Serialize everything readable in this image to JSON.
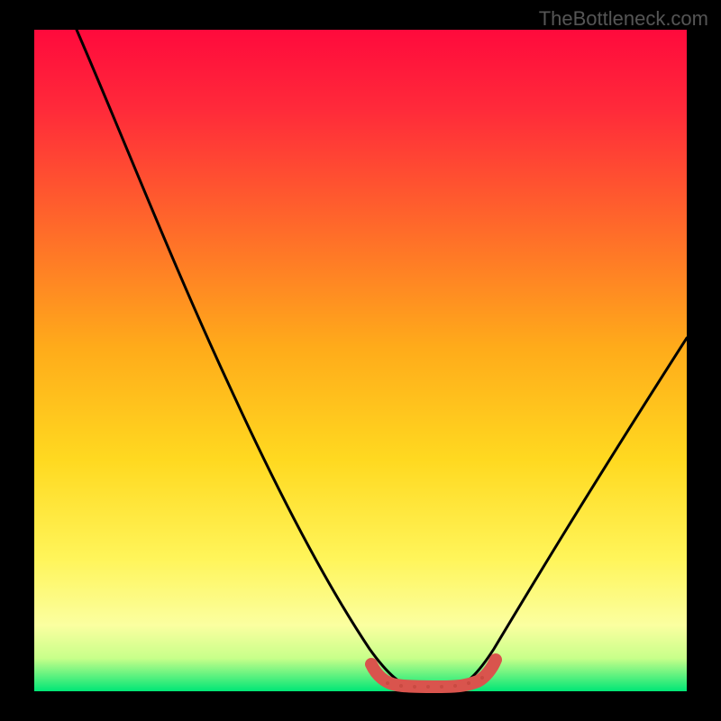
{
  "watermark": "TheBottleneck.com",
  "chart_data": {
    "type": "line",
    "title": "",
    "xlabel": "",
    "ylabel": "",
    "xlim": [
      0,
      100
    ],
    "ylim": [
      0,
      100
    ],
    "legend": false,
    "grid": false,
    "annotations": [],
    "background": {
      "style": "heat-gradient",
      "stops": [
        {
          "offset": 0,
          "color": "#ff1744"
        },
        {
          "offset": 50,
          "color": "#ffd740"
        },
        {
          "offset": 88,
          "color": "#ffff8d"
        },
        {
          "offset": 100,
          "color": "#00e676"
        }
      ]
    },
    "series": [
      {
        "name": "bottleneck-curve",
        "color": "#000000",
        "x": [
          9,
          14,
          20,
          26,
          32,
          38,
          44,
          48,
          52,
          56,
          58,
          60,
          62,
          66,
          72,
          80,
          90,
          100
        ],
        "values": [
          100,
          88,
          75,
          62,
          49,
          36,
          23,
          14,
          6,
          2,
          0,
          0,
          2,
          8,
          18,
          32,
          46,
          58
        ]
      },
      {
        "name": "optimal-zone-band",
        "color": "#d9544d",
        "x": [
          52,
          54,
          56,
          58,
          60,
          62,
          64,
          66
        ],
        "values": [
          2,
          1,
          0,
          0,
          0,
          0,
          1,
          2
        ]
      }
    ]
  }
}
